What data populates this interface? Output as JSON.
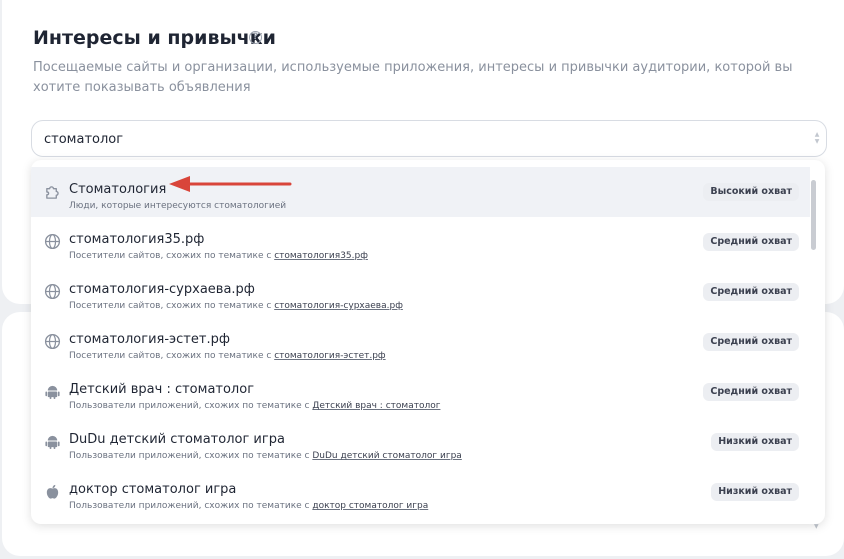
{
  "header": {
    "title": "Интересы и привычки",
    "help_glyph": "?",
    "description": "Посещаемые сайты и организации, используемые приложения, интересы и привычки аудитории, которой вы хотите показывать объявления"
  },
  "search": {
    "value": "стоматолог"
  },
  "options": [
    {
      "icon": "puzzle-icon",
      "title": "Стоматология",
      "sub_prefix": "Люди, которые интересуются стоматологией",
      "link": "",
      "badge": "Высокий охват"
    },
    {
      "icon": "globe-icon",
      "title": "стоматология35.рф",
      "sub_prefix": "Посетители сайтов, схожих по тематике с ",
      "link": "стоматология35.рф",
      "badge": "Средний охват"
    },
    {
      "icon": "globe-icon",
      "title": "стоматология-сурхаева.рф",
      "sub_prefix": "Посетители сайтов, схожих по тематике с ",
      "link": "стоматология-сурхаева.рф",
      "badge": "Средний охват"
    },
    {
      "icon": "globe-icon",
      "title": "стоматология-эстет.рф",
      "sub_prefix": "Посетители сайтов, схожих по тематике с ",
      "link": "стоматология-эстет.рф",
      "badge": "Средний охват"
    },
    {
      "icon": "android-icon",
      "title": "Детский врач : стоматолог",
      "sub_prefix": "Пользователи приложений, схожих по тематике с ",
      "link": "Детский врач : стоматолог",
      "badge": "Средний охват"
    },
    {
      "icon": "android-icon",
      "title": "DuDu детский стоматолог игра",
      "sub_prefix": "Пользователи приложений, схожих по тематике с ",
      "link": "DuDu детский стоматолог игра",
      "badge": "Низкий охват"
    },
    {
      "icon": "apple-icon",
      "title": "доктор стоматолог игра",
      "sub_prefix": "Пользователи приложений, схожих по тематике с ",
      "link": "доктор стоматолог игра",
      "badge": "Низкий охват"
    }
  ],
  "colors": {
    "accent_arrow": "#d9453a",
    "highlight_row": "#f0f2f6"
  }
}
